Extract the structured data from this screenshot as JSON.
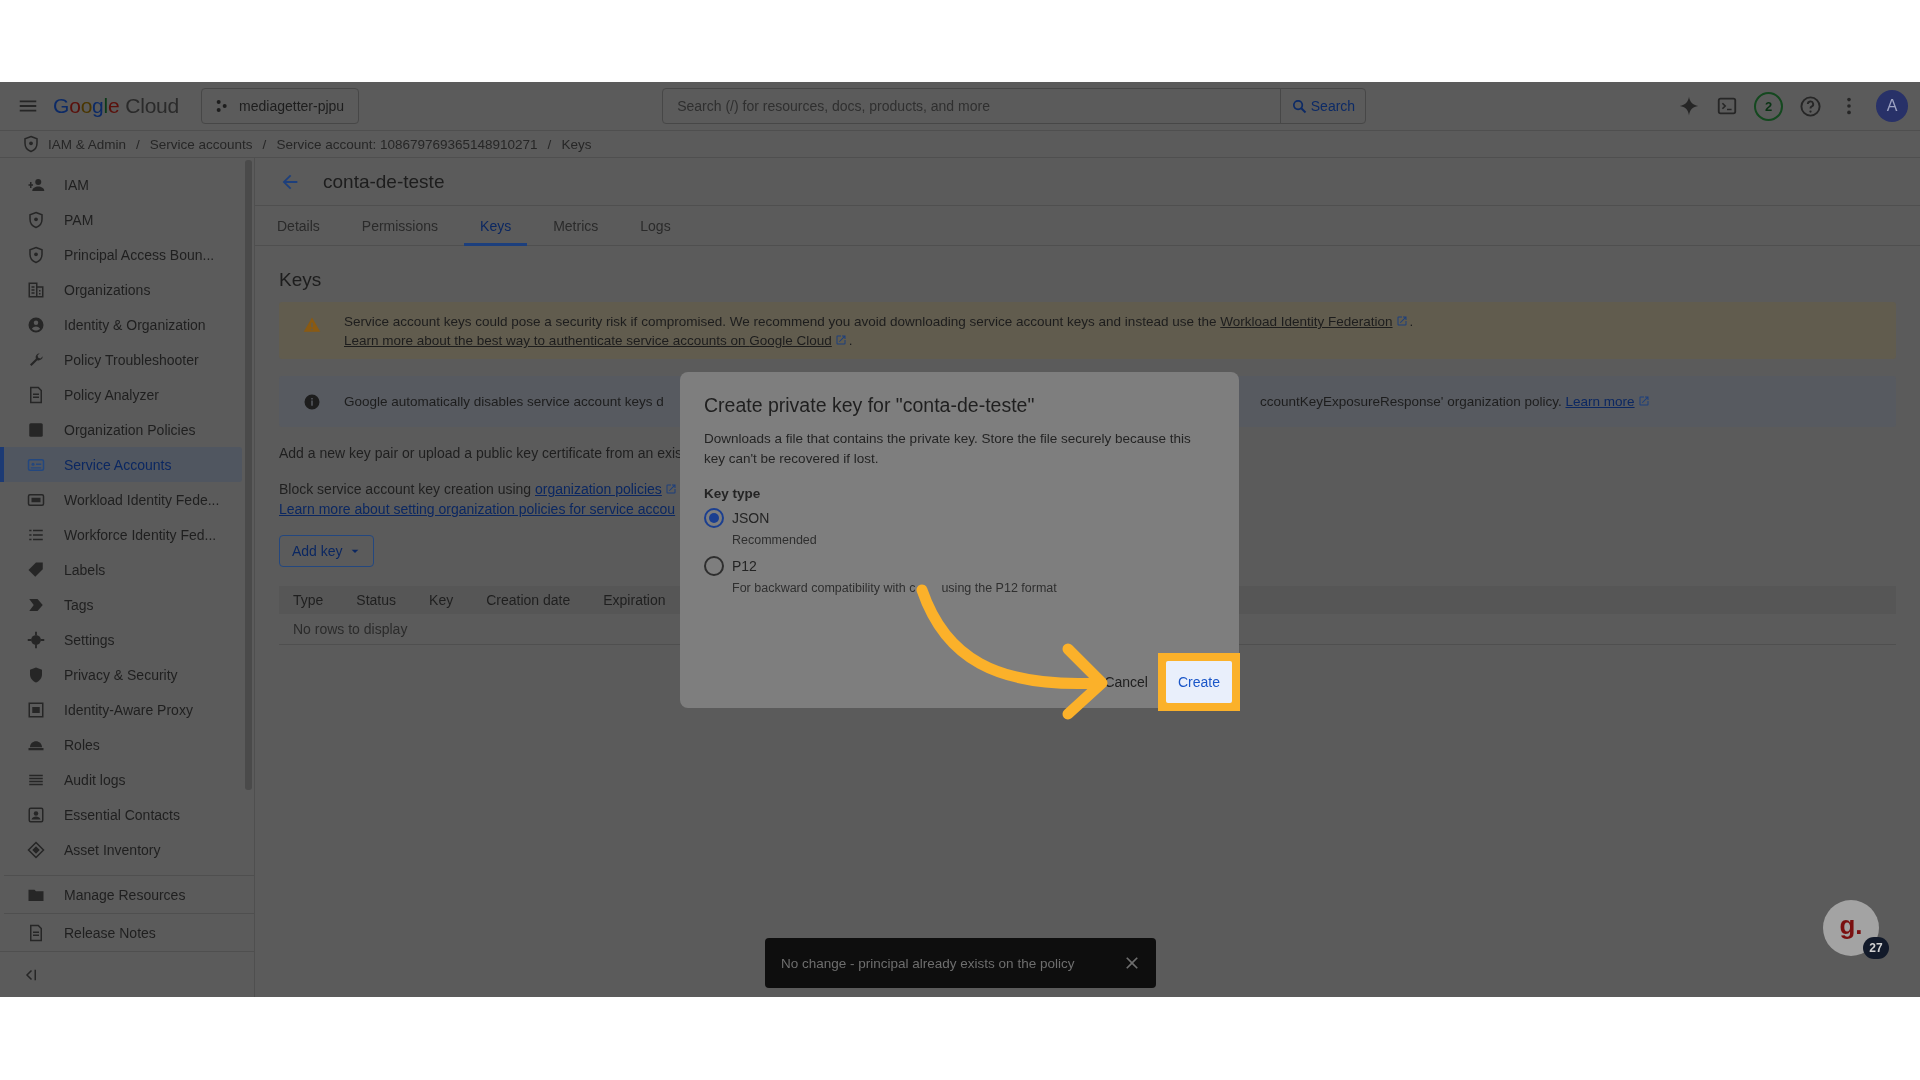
{
  "topbar": {
    "logo": "Google Cloud",
    "project": "mediagetter-pjpu",
    "search": {
      "placeholder": "Search (/) for resources, docs, products, and more",
      "button": "Search"
    },
    "notifications": "2",
    "avatar": "A"
  },
  "breadcrumb": {
    "separator": "/",
    "items": [
      {
        "label": "IAM & Admin"
      },
      {
        "label": "Service accounts"
      },
      {
        "label": "Service account: 108679769365148910271"
      },
      {
        "label": "Keys"
      }
    ]
  },
  "sidebar": {
    "items": [
      {
        "label": "IAM",
        "selected": false
      },
      {
        "label": "PAM",
        "selected": false
      },
      {
        "label": "Principal Access Boun...",
        "selected": false
      },
      {
        "label": "Organizations",
        "selected": false
      },
      {
        "label": "Identity & Organization",
        "selected": false
      },
      {
        "label": "Policy Troubleshooter",
        "selected": false
      },
      {
        "label": "Policy Analyzer",
        "selected": false
      },
      {
        "label": "Organization Policies",
        "selected": false
      },
      {
        "label": "Service Accounts",
        "selected": true
      },
      {
        "label": "Workload Identity Fede...",
        "selected": false
      },
      {
        "label": "Workforce Identity Fed...",
        "selected": false
      },
      {
        "label": "Labels",
        "selected": false
      },
      {
        "label": "Tags",
        "selected": false
      },
      {
        "label": "Settings",
        "selected": false
      },
      {
        "label": "Privacy & Security",
        "selected": false
      },
      {
        "label": "Identity-Aware Proxy",
        "selected": false
      },
      {
        "label": "Roles",
        "selected": false
      },
      {
        "label": "Audit logs",
        "selected": false
      },
      {
        "label": "Essential Contacts",
        "selected": false
      },
      {
        "label": "Asset Inventory",
        "selected": false
      }
    ],
    "footer": [
      {
        "label": "Manage Resources"
      },
      {
        "label": "Release Notes"
      }
    ]
  },
  "page": {
    "title": "conta-de-teste",
    "tabs": [
      {
        "label": "Details",
        "selected": false
      },
      {
        "label": "Permissions",
        "selected": false
      },
      {
        "label": "Keys",
        "selected": true
      },
      {
        "label": "Metrics",
        "selected": false
      },
      {
        "label": "Logs",
        "selected": false
      }
    ],
    "heading": "Keys",
    "warning": [
      {
        "kind": "text",
        "text": "Service account keys could pose a security risk if compromised. We recommend you avoid downloading service account keys and instead use the "
      },
      {
        "kind": "link",
        "text": "Workload Identity Federation",
        "external": true
      },
      {
        "kind": "text",
        "text": ". "
      },
      {
        "kind": "link",
        "text": "Learn more about the best way to authenticate service accounts on ",
        "external": false
      },
      {
        "kind": "link",
        "text": "Google Cloud",
        "external": true
      },
      {
        "kind": "text",
        "text": "."
      }
    ],
    "info": {
      "left": "Google automatically disables service account keys d",
      "right": [
        {
          "kind": "text",
          "text": "ccountKeyExposureResponse' organization policy. "
        },
        {
          "kind": "link",
          "text": "Learn more",
          "external": true
        }
      ]
    },
    "add_text": "Add a new key pair or upload a public key certificate from an exis",
    "block": [
      {
        "kind": "text",
        "text": "Block service account key creation using "
      },
      {
        "kind": "link",
        "text": "organization policies",
        "external": true
      }
    ],
    "learn_link": "Learn more about setting organization policies for service accou",
    "add_button": "Add key",
    "table": {
      "columns": [
        "Type",
        "Status",
        "Key",
        "Creation date",
        "Expiration"
      ],
      "empty": "No rows to display"
    }
  },
  "dialog": {
    "title": "Create private key for \"conta-de-teste\"",
    "description": "Downloads a file that contains the private key. Store the file securely because this key can't be recovered if lost.",
    "group_label": "Key type",
    "options": [
      {
        "label": "JSON",
        "hint": [
          "Recommended"
        ],
        "selected": true
      },
      {
        "label": "P12",
        "hint": [
          "For backward compatibility with c",
          "using the P12 format"
        ],
        "selected": false
      }
    ],
    "buttons": [
      {
        "label": "Cancel",
        "highlighted": false
      },
      {
        "label": "Create",
        "highlighted": true
      }
    ]
  },
  "annotation": {
    "kind": "arrow"
  },
  "snackbar": {
    "text": "No change - principal already exists on the policy"
  },
  "assistant": {
    "label": "g.",
    "badge": "27"
  }
}
